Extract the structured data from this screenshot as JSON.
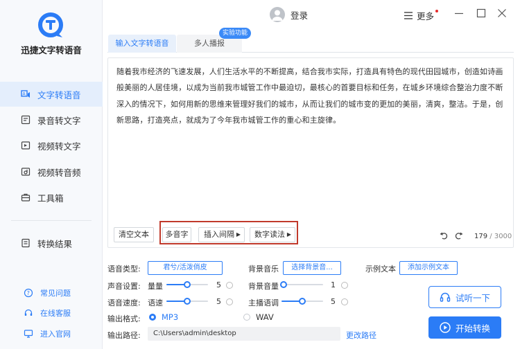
{
  "app": {
    "name": "迅捷文字转语音"
  },
  "titlebar": {
    "login_label": "登录",
    "more_label": "更多"
  },
  "sidebar": {
    "items": [
      {
        "label": "文字转语音",
        "active": true
      },
      {
        "label": "录音转文字"
      },
      {
        "label": "视频转文字"
      },
      {
        "label": "视频转音频"
      },
      {
        "label": "工具箱"
      },
      {
        "label": "转换结果"
      }
    ],
    "links": [
      {
        "label": "常见问题"
      },
      {
        "label": "在线客服"
      },
      {
        "label": "进入官网"
      }
    ]
  },
  "tabs": [
    {
      "label": "输入文字转语音",
      "active": true
    },
    {
      "label": "多人播报"
    }
  ],
  "badge": {
    "label": "实验功能"
  },
  "editor": {
    "text": "随着我市经济的飞速发展，人们生活水平的不断提高，结合我市实际，打造具有特色的现代田园城市，创造如诗画般美丽的人居佳境，以成为当前我市城管工作中最迫切，最核心的首要目标和任务，在城乡环境综合整治力度不断深入的情况下，如何用新的思维来管理好我们的城市，从而让我们的城市变的更加的美丽，清爽，整洁。于是，创新思路，打造亮点，就成为了今年我市城管工作的重心和主旋律。",
    "count": "179",
    "max": "/ 3000"
  },
  "toolbar": {
    "clear_label": "清空文本",
    "polyphone_label": "多音字",
    "insert_pause_label": "插入间隔",
    "number_read_label": "数字读法"
  },
  "settings": {
    "voice_type_label": "语音类型:",
    "voice_type_value": "君兮/活泼俏皮",
    "bg_music_label": "背景音乐",
    "bg_music_value": "选择背景音...",
    "sample_label": "示例文本",
    "sample_value": "添加示例文本",
    "voice_setting_label": "声音设置:",
    "volume_label": "量量",
    "volume_value": "5",
    "bg_volume_label": "背景音量",
    "bg_volume_value": "1",
    "speed_label": "语音速度:",
    "speed_sub_label": "语速",
    "speed_value": "5",
    "pitch_label": "主播语调",
    "pitch_value": "5",
    "format_label": "输出格式:",
    "format_mp3": "MP3",
    "format_wav": "WAV",
    "path_label": "输出路径:",
    "path_value": "C:\\Users\\admin\\desktop",
    "change_path_label": "更改路径"
  },
  "sliders": {
    "volume": 0.5,
    "bg_volume": 0.05,
    "speed": 0.5,
    "pitch": 0.5
  },
  "actions": {
    "listen_label": "试听一下",
    "start_label": "开始转换"
  },
  "colors": {
    "accent": "#2b7cf6",
    "highlight_box": "#c0392b",
    "sidebar_active_bg": "#e4eefc"
  }
}
